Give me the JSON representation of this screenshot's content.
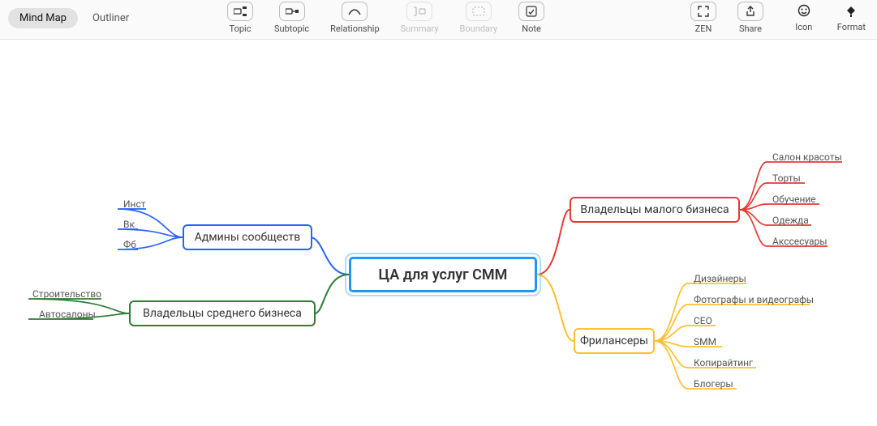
{
  "toolbar": {
    "view": {
      "mindmap": "Mind Map",
      "outliner": "Outliner"
    },
    "buttons": {
      "topic": "Topic",
      "subtopic": "Subtopic",
      "relationship": "Relationship",
      "summary": "Summary",
      "boundary": "Boundary",
      "note": "Note",
      "zen": "ZEN",
      "share": "Share",
      "icon": "Icon",
      "format": "Format"
    }
  },
  "mindmap": {
    "central": "ЦА для услуг СММ",
    "branches": {
      "admins": {
        "label": "Админы сообществ",
        "color": "#2962ff",
        "children": [
          "Инст",
          "Вк",
          "Фб"
        ]
      },
      "mid_biz": {
        "label": "Владельцы среднего бизнеса",
        "color": "#2e7d32",
        "children": [
          "Строительство",
          "Автосалоны"
        ]
      },
      "small_biz": {
        "label": "Владельцы малого бизнеса",
        "color": "#e53935",
        "children": [
          "Салон красоты",
          "Торты",
          "Обучение",
          "Одежда",
          "Акссесуары"
        ]
      },
      "freelance": {
        "label": "Фрилансеры",
        "color": "#fbc02d",
        "children": [
          "Дизайнеры",
          "Фотографы и видеографы",
          "CEO",
          "SMM",
          "Копирайтинг",
          "Блогеры"
        ]
      }
    }
  }
}
